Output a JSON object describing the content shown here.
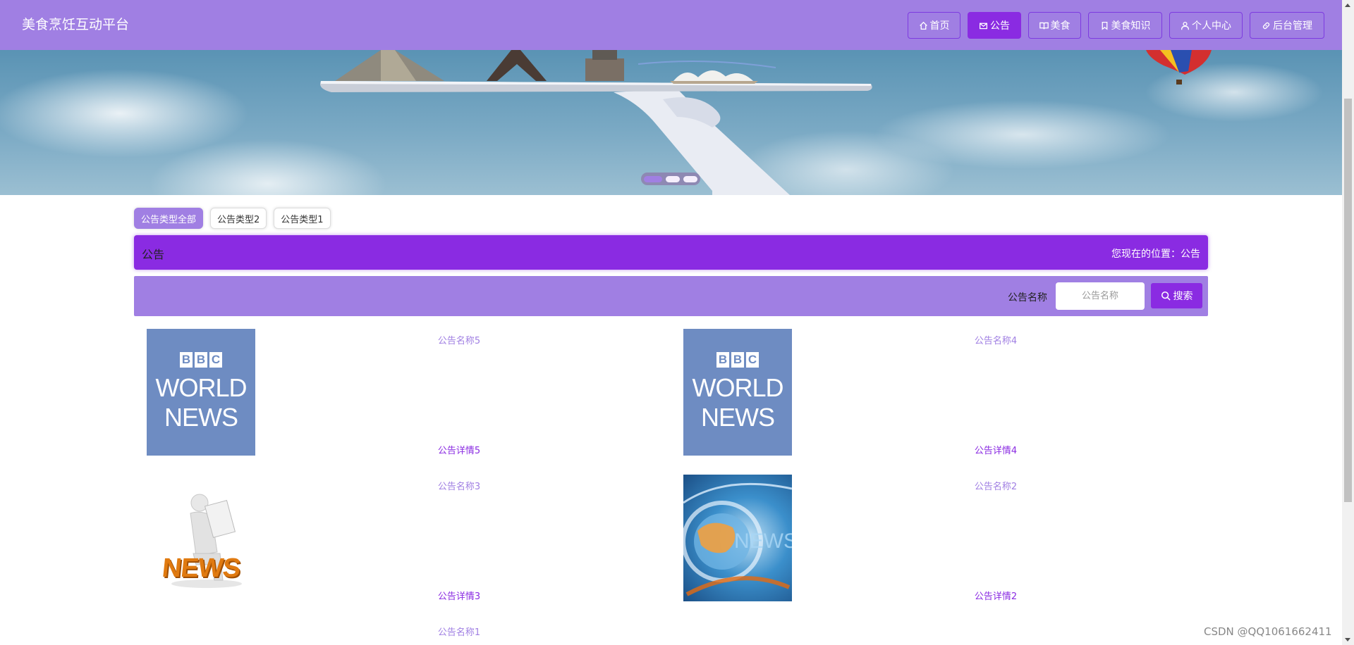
{
  "header": {
    "brand": "美食烹饪互动平台",
    "nav": [
      {
        "label": "首页",
        "icon": "home-icon",
        "active": false
      },
      {
        "label": "公告",
        "icon": "mail-icon",
        "active": true
      },
      {
        "label": "美食",
        "icon": "book-open-icon",
        "active": false
      },
      {
        "label": "美食知识",
        "icon": "bookmark-icon",
        "active": false
      },
      {
        "label": "个人中心",
        "icon": "user-icon",
        "active": false
      },
      {
        "label": "后台管理",
        "icon": "link-icon",
        "active": false
      }
    ]
  },
  "carousel": {
    "slides": 3,
    "active_index": 0
  },
  "filters": [
    {
      "label": "公告类型全部",
      "active": true
    },
    {
      "label": "公告类型2",
      "active": false
    },
    {
      "label": "公告类型1",
      "active": false
    }
  ],
  "titlebar": {
    "title": "公告",
    "breadcrumb": "您现在的位置：公告"
  },
  "search": {
    "label": "公告名称",
    "placeholder": "公告名称",
    "button": "搜索"
  },
  "items": [
    {
      "name": "公告名称5",
      "detail": "公告详情5",
      "image": "bbc-world-news"
    },
    {
      "name": "公告名称4",
      "detail": "公告详情4",
      "image": "bbc-world-news"
    },
    {
      "name": "公告名称3",
      "detail": "公告详情3",
      "image": "news-reader-figure"
    },
    {
      "name": "公告名称2",
      "detail": "公告详情2",
      "image": "news-globe"
    },
    {
      "name": "公告名称1",
      "detail": "",
      "image": ""
    }
  ],
  "bbc_logo": {
    "letters": [
      "B",
      "B",
      "C"
    ],
    "line1": "WORLD",
    "line2": "NEWS"
  },
  "news_logo_text": "NEWS",
  "watermark": "CSDN @QQ1061662411",
  "colors": {
    "primary": "#8a2be2",
    "secondary": "#a07fe3"
  }
}
